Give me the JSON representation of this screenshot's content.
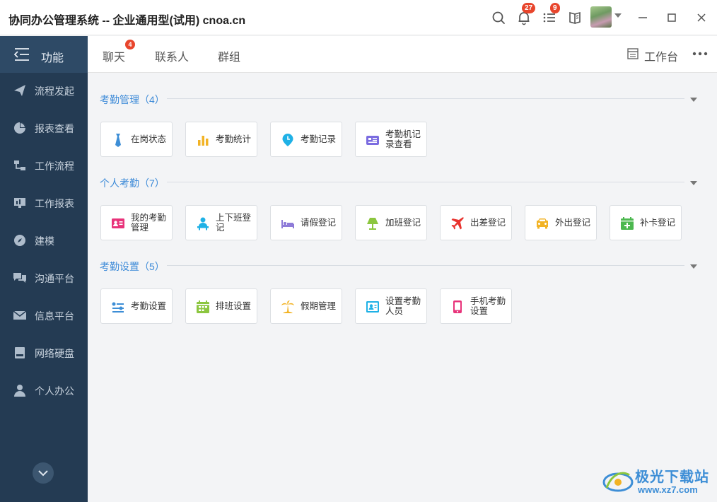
{
  "window": {
    "title": "协同办公管理系统 -- 企业通用型(试用) cnoa.cn",
    "notifications_count": "27",
    "tasks_count": "9"
  },
  "sidebar": {
    "header_label": "功能",
    "items": [
      {
        "label": "流程发起",
        "icon": "send-icon"
      },
      {
        "label": "报表查看",
        "icon": "pie-chart-icon"
      },
      {
        "label": "工作流程",
        "icon": "workflow-icon"
      },
      {
        "label": "工作报表",
        "icon": "report-icon"
      },
      {
        "label": "建模",
        "icon": "compass-icon"
      },
      {
        "label": "沟通平台",
        "icon": "chat-icon"
      },
      {
        "label": "信息平台",
        "icon": "mail-icon"
      },
      {
        "label": "网络硬盘",
        "icon": "disk-icon"
      },
      {
        "label": "个人办公",
        "icon": "person-icon"
      }
    ]
  },
  "tabs": {
    "chat": "聊天",
    "chat_badge": "4",
    "contacts": "联系人",
    "groups": "群组",
    "workbench": "工作台"
  },
  "sections": [
    {
      "title": "考勤管理（4）",
      "items": [
        {
          "label": "在岗状态",
          "icon": "tie-icon",
          "color": "#3d8ed6"
        },
        {
          "label": "考勤统计",
          "icon": "bar-chart-icon",
          "color": "#f2b325"
        },
        {
          "label": "考勤记录",
          "icon": "clock-pin-icon",
          "color": "#1fb1e6"
        },
        {
          "label": "考勤机记录查看",
          "icon": "card-reader-icon",
          "color": "#7b6ce0"
        }
      ]
    },
    {
      "title": "个人考勤（7）",
      "items": [
        {
          "label": "我的考勤管理",
          "icon": "id-card-icon",
          "color": "#e8337a"
        },
        {
          "label": "上下班登记",
          "icon": "user-desk-icon",
          "color": "#1fb1e6"
        },
        {
          "label": "请假登记",
          "icon": "bed-icon",
          "color": "#8e7bd8"
        },
        {
          "label": "加班登记",
          "icon": "lamp-icon",
          "color": "#8cc63f"
        },
        {
          "label": "出差登记",
          "icon": "airplane-icon",
          "color": "#e8332e"
        },
        {
          "label": "外出登记",
          "icon": "car-icon",
          "color": "#f2b325"
        },
        {
          "label": "补卡登记",
          "icon": "calendar-add-icon",
          "color": "#4cb84f"
        }
      ]
    },
    {
      "title": "考勤设置（5）",
      "items": [
        {
          "label": "考勤设置",
          "icon": "settings-list-icon",
          "color": "#3d8ed6"
        },
        {
          "label": "排班设置",
          "icon": "schedule-icon",
          "color": "#8cc63f"
        },
        {
          "label": "假期管理",
          "icon": "palm-tree-icon",
          "color": "#f2b325"
        },
        {
          "label": "设置考勤人员",
          "icon": "user-card-icon",
          "color": "#1fb1e6"
        },
        {
          "label": "手机考勤设置",
          "icon": "mobile-icon",
          "color": "#e8337a"
        }
      ]
    }
  ],
  "watermark": {
    "name": "极光下载站",
    "url": "www.xz7.com"
  }
}
